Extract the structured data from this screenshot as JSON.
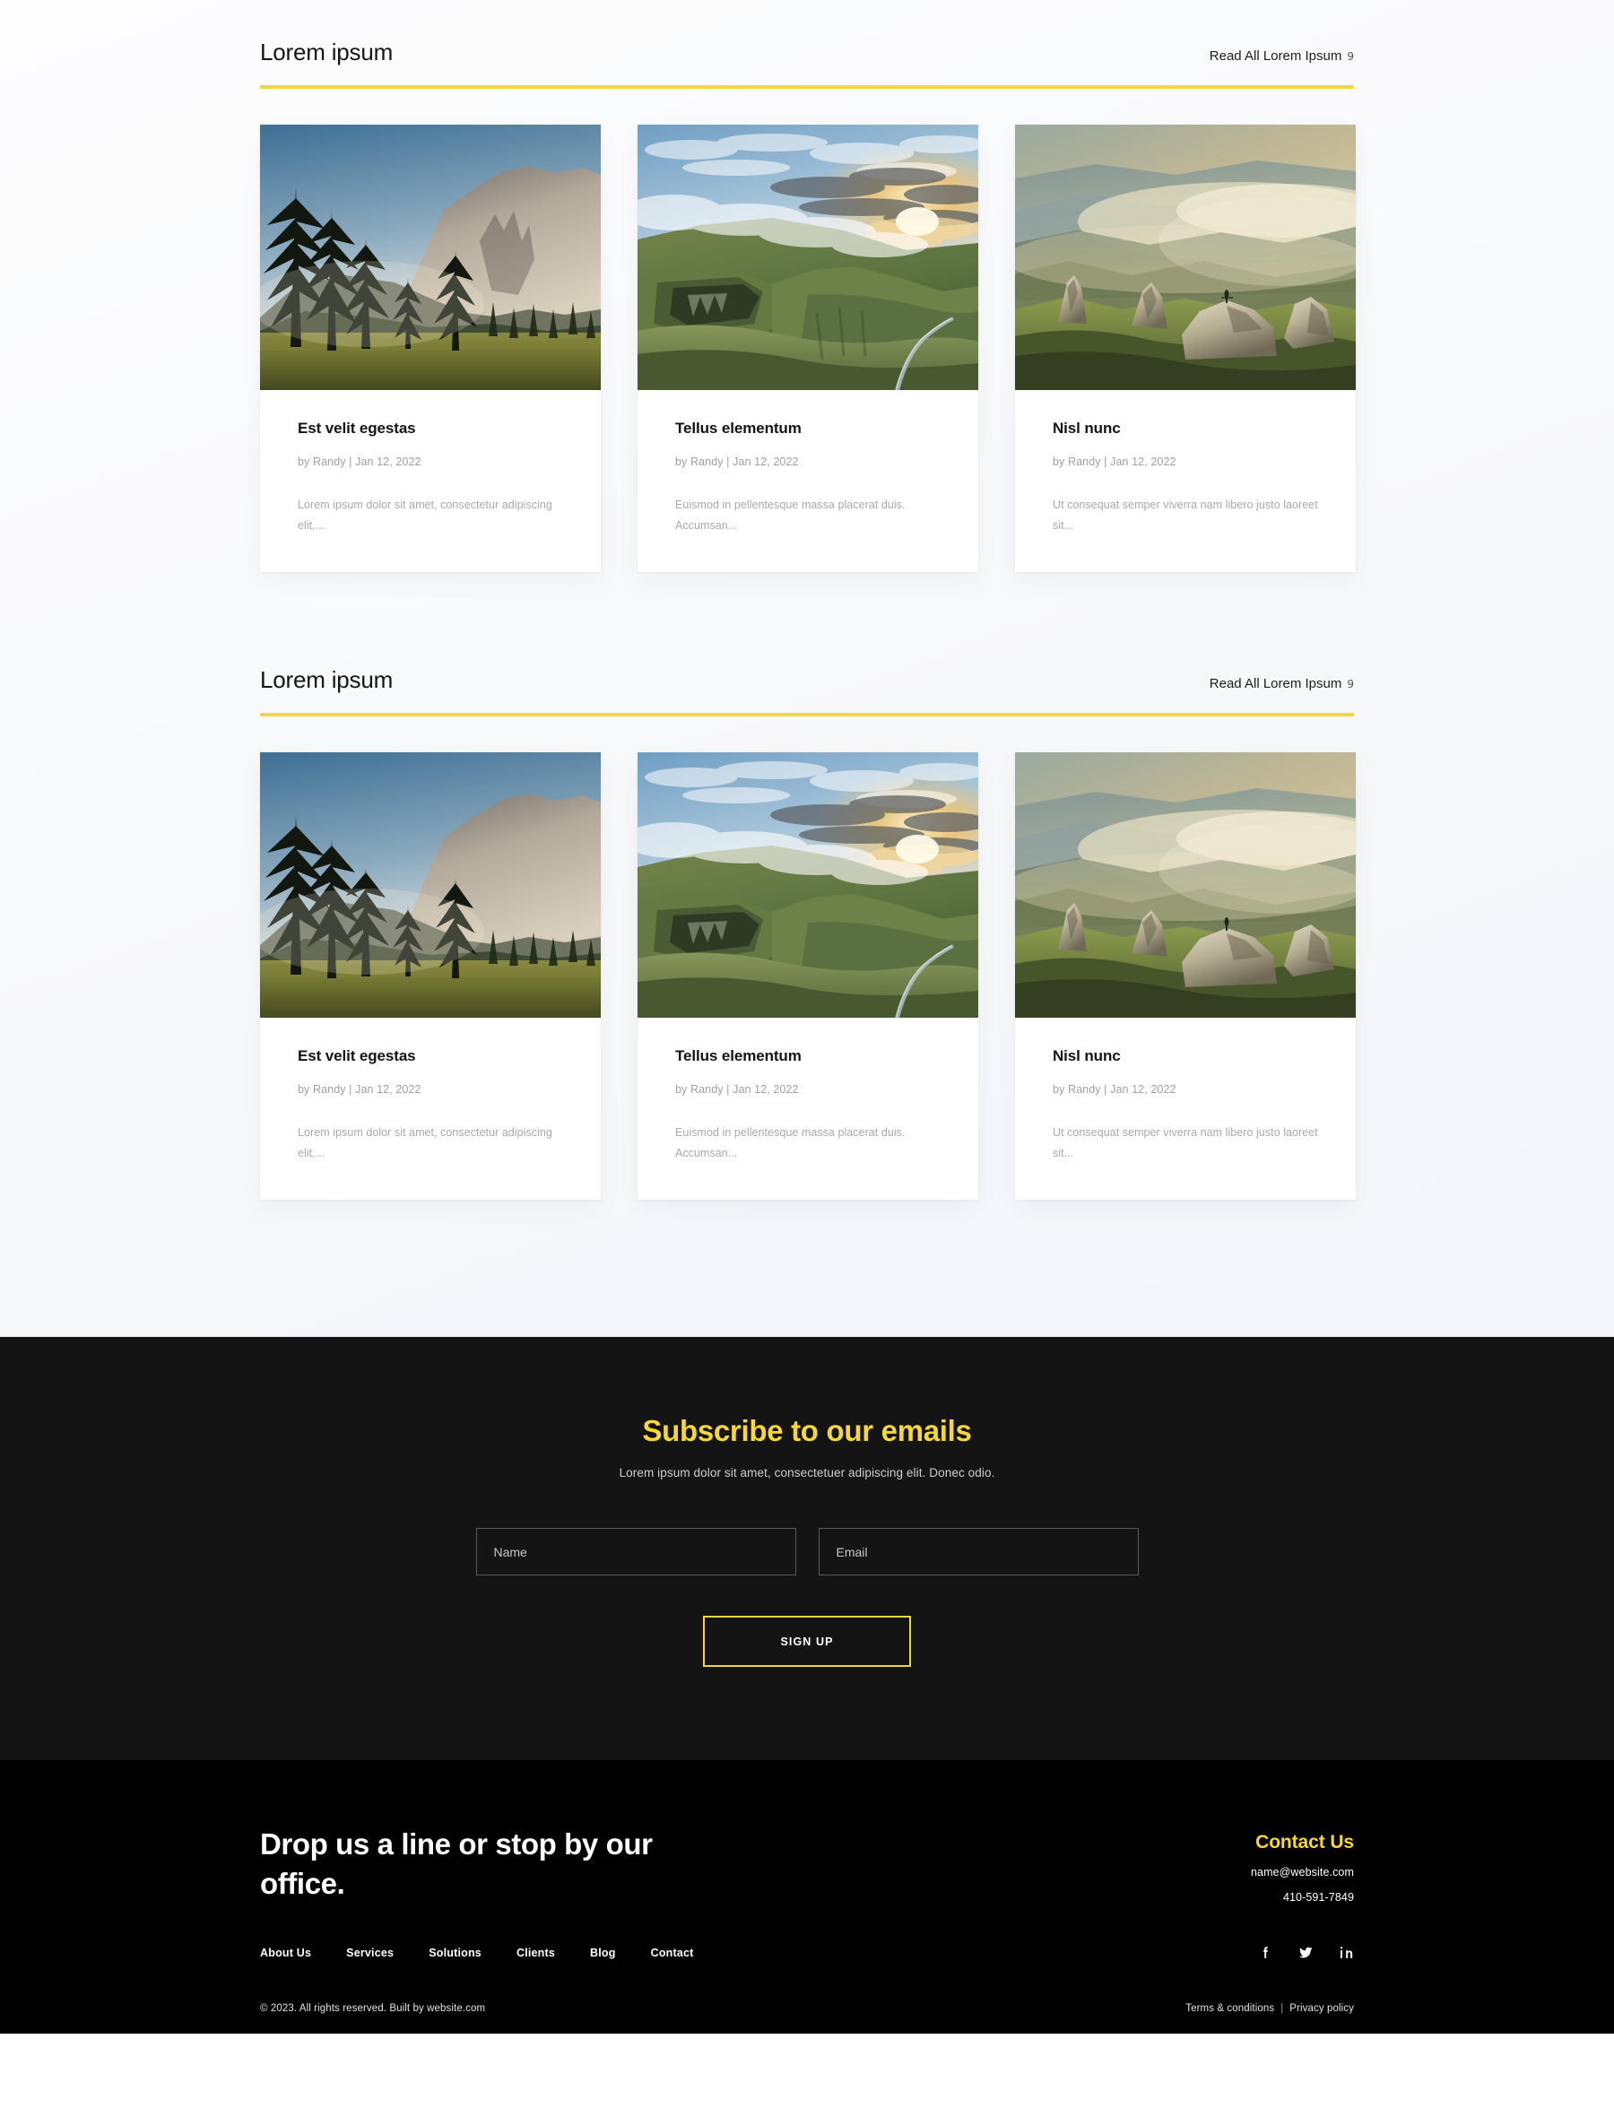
{
  "theme": {
    "accent_yellow": "#f5d73c",
    "subscribe_bg": "#141414",
    "footer_bg": "#000000",
    "page_bg": "#f8f9fb"
  },
  "sections": [
    {
      "title": "Lorem ipsum",
      "read_all_label": "Read All Lorem Ipsum",
      "read_all_arrow": "9",
      "cards": [
        {
          "image_name": "yosemite-el-capitan-meadow-photo",
          "title": "Est velit egestas",
          "meta": "by Randy | Jan 12, 2022",
          "excerpt": "Lorem ipsum dolor sit amet, consectetur adipiscing elit,..."
        },
        {
          "image_name": "quiraing-skye-sunset-valley-photo",
          "title": "Tellus elementum",
          "meta": "by Randy | Jan 12, 2022",
          "excerpt": "Euismod in pellentesque massa placerat duis. Accumsan..."
        },
        {
          "image_name": "hazy-golden-mountain-ridge-photo",
          "title": "Nisl nunc",
          "meta": "by Randy | Jan 12, 2022",
          "excerpt": "Ut consequat semper viverra nam libero justo laoreet sit..."
        }
      ]
    },
    {
      "title": "Lorem ipsum",
      "read_all_label": "Read All Lorem Ipsum",
      "read_all_arrow": "9",
      "cards": [
        {
          "image_name": "yosemite-el-capitan-meadow-photo",
          "title": "Est velit egestas",
          "meta": "by Randy | Jan 12, 2022",
          "excerpt": "Lorem ipsum dolor sit amet, consectetur adipiscing elit,..."
        },
        {
          "image_name": "quiraing-skye-sunset-valley-photo",
          "title": "Tellus elementum",
          "meta": "by Randy | Jan 12, 2022",
          "excerpt": "Euismod in pellentesque massa placerat duis. Accumsan..."
        },
        {
          "image_name": "hazy-golden-mountain-ridge-photo",
          "title": "Nisl nunc",
          "meta": "by Randy | Jan 12, 2022",
          "excerpt": "Ut consequat semper viverra nam libero justo laoreet sit..."
        }
      ]
    }
  ],
  "subscribe": {
    "heading": "Subscribe to our emails",
    "subheading": "Lorem ipsum dolor sit amet, consectetuer adipiscing elit. Donec odio.",
    "name_placeholder": "Name",
    "name_value": "",
    "email_placeholder": "Email",
    "email_value": "",
    "button_label": "SIGN UP"
  },
  "footer": {
    "tagline": "Drop us a line or stop by our office.",
    "contact_title": "Contact Us",
    "email": "name@website.com",
    "phone": "410-591-7849",
    "nav": [
      {
        "label": "About Us"
      },
      {
        "label": "Services"
      },
      {
        "label": "Solutions"
      },
      {
        "label": "Clients"
      },
      {
        "label": "Blog"
      },
      {
        "label": "Contact"
      }
    ],
    "socials": [
      {
        "name": "facebook-icon"
      },
      {
        "name": "twitter-icon"
      },
      {
        "name": "linkedin-icon"
      }
    ],
    "copyright": "© 2023. All rights reserved. Built by website.com",
    "terms_label": "Terms & conditions",
    "legal_separator": "|",
    "privacy_label": "Privacy policy"
  }
}
